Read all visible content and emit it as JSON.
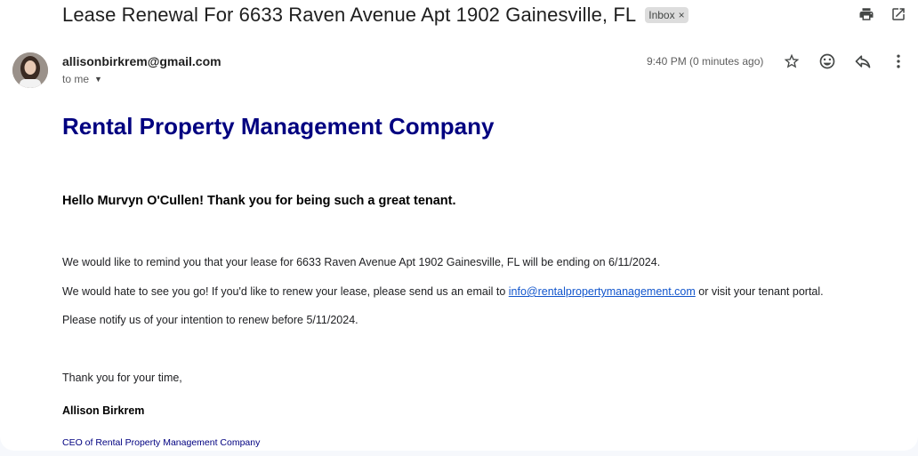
{
  "email": {
    "subject": "Lease Renewal For 6633 Raven Avenue Apt 1902 Gainesville, FL",
    "label": "Inbox",
    "label_remove": "×",
    "sender": "allisonbirkrem@gmail.com",
    "to": "to me",
    "time": "9:40 PM (0 minutes ago)"
  },
  "icons": {
    "top": [
      "print-icon",
      "open-in-new-window-icon"
    ],
    "message": [
      "star-icon",
      "emoji-reaction-icon",
      "reply-icon",
      "more-options-icon"
    ]
  },
  "body": {
    "company": "Rental Property Management Company",
    "greeting": "Hello Murvyn O'Cullen! Thank you for being such a great tenant.",
    "p1": "We would like to remind you that your lease for 6633 Raven Avenue Apt 1902 Gainesville, FL will be ending on 6/11/2024.",
    "p2_before": "We would hate to see you go! If you'd like to renew your lease, please send us an email to ",
    "p2_link": "info@rentalpropertymanagement.com",
    "p2_after": " or visit your tenant portal.",
    "p3": "Please notify us of your intention to renew before 5/11/2024.",
    "p4": "Thank you for your time,",
    "signature": "Allison Birkrem",
    "signature_title": "CEO of Rental Property Management Company"
  },
  "colors": {
    "company_title": "#000080",
    "link": "#1155cc",
    "chip_bg": "#dddddd"
  }
}
